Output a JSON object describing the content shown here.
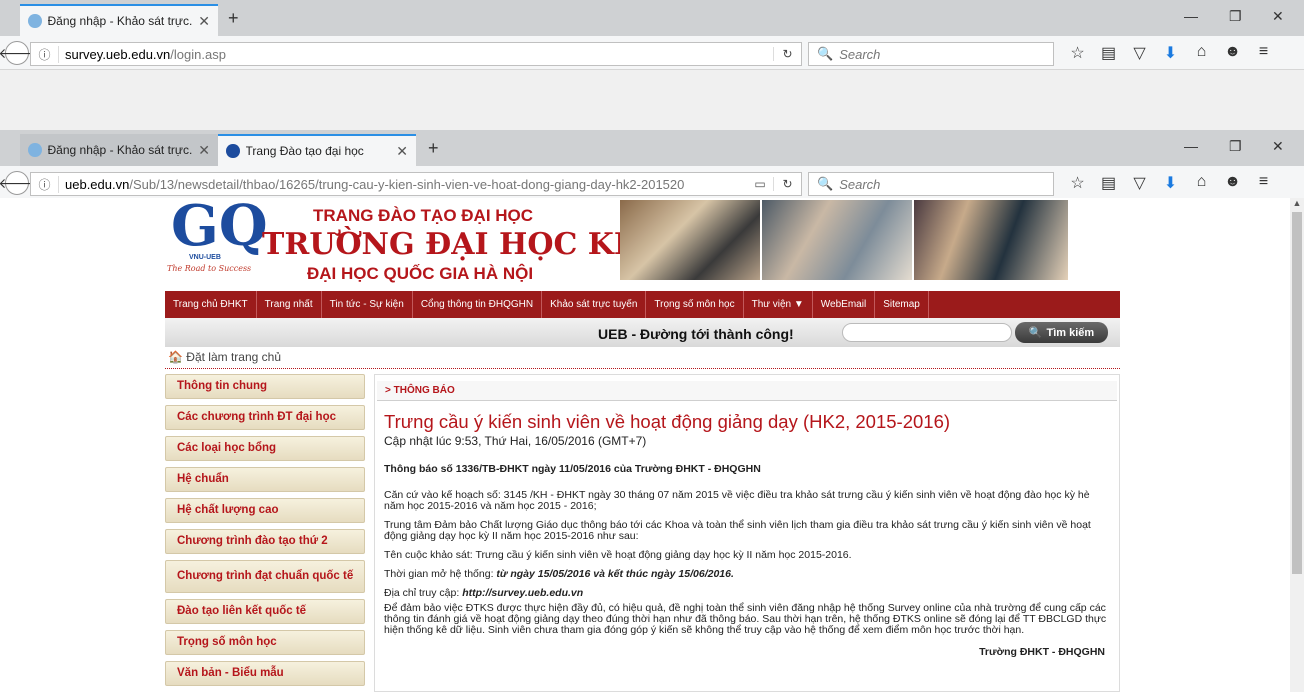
{
  "window1": {
    "tabs": [
      {
        "label": "Đăng nhập - Khảo sát trực..."
      }
    ],
    "url_domain": "survey.ueb.edu.vn",
    "url_path": "/login.asp",
    "search_placeholder": "Search"
  },
  "window2": {
    "tabs": [
      {
        "label": "Đăng nhập - Khảo sát trực..."
      },
      {
        "label": "Trang Đào tạo đại học"
      }
    ],
    "url_domain": "ueb.edu.vn",
    "url_path": "/Sub/13/newsdetail/thbao/16265/trung-cau-y-kien-sinh-vien-ve-hoat-dong-giang-day-hk2-201520",
    "search_placeholder": "Search"
  },
  "header": {
    "line1": "TRANG ĐÀO TẠO ĐẠI HỌC",
    "line2": "TRƯỜNG ĐẠI HỌC KINH TẾ",
    "line3": "ĐẠI HỌC QUỐC GIA HÀ NỘI",
    "logo_sub": "VNU-UEB",
    "logo_tagline": "The Road to Success"
  },
  "menu": [
    "Trang chủ ĐHKT",
    "Trang nhất",
    "Tin tức - Sự kiện",
    "Cổng thông tin ĐHQGHN",
    "Khảo sát trực tuyến",
    "Trọng số môn học",
    "Thư viện ▼",
    "WebEmail",
    "Sitemap"
  ],
  "slogan": "UEB - Đường tới thành công!",
  "search_button": "Tìm kiếm",
  "home_link": "Đặt làm trang chủ",
  "sidebar": [
    "Thông tin chung",
    "Các chương trình ĐT đại học",
    "Các loại học bổng",
    "Hệ chuẩn",
    "Hệ chất lượng cao",
    "Chương trình đào tạo thứ 2",
    "Chương trình đạt chuẩn quốc tế",
    "Đào tạo liên kết quốc tế",
    "Trọng số môn học",
    "Văn bản - Biểu mẫu"
  ],
  "article": {
    "section": "> THÔNG BÁO",
    "title": "Trưng cầu ý kiến sinh viên về hoạt động giảng dạy (HK2, 2015-2016)",
    "updated": "Cập nhật lúc 9:53, Thứ Hai, 16/05/2016 (GMT+7)",
    "notice_no": "Thông báo số 1336/TB-ĐHKT ngày 11/05/2016 của Trường ĐHKT - ĐHQGHN",
    "p1": "Căn cứ vào kế hoạch số: 3145 /KH - ĐHKT ngày 30 tháng 07 năm 2015 về việc điều tra khảo sát trưng cầu ý kiến sinh viên về hoạt động đào học kỳ hè năm học 2015-2016 và năm học 2015 - 2016;",
    "p2": "Trung tâm Đảm bảo Chất lượng Giáo dục thông báo tới các Khoa và toàn thể sinh viên lịch tham gia điều tra khảo sát trưng cầu ý kiến sinh viên về hoạt động giảng dạy học kỳ II năm học 2015-2016 như sau:",
    "p3": "Tên cuộc khảo sát: Trưng cầu ý kiến sinh viên về hoạt động giảng dạy học kỳ II năm học 2015-2016.",
    "p4_label": "Thời gian mở hệ thống: ",
    "p4_value": "từ ngày 15/05/2016 và kết thúc ngày 15/06/2016.",
    "p5_label": "Địa chỉ truy cập: ",
    "p5_value": "http://survey.ueb.edu.vn",
    "p6": "Để đảm bảo việc ĐTKS được thực hiện đầy đủ, có hiệu quả, đề nghị toàn thể sinh viên đăng nhập hệ thống Survey online của nhà trường để cung cấp các thông tin đánh giá về hoạt động giảng dạy theo đúng thời hạn như đã thông báo. Sau thời hạn trên, hệ thống ĐTKS online sẽ đóng lại để TT ĐBCLGD thực hiện thống kê dữ liệu. Sinh viên chưa tham gia đóng góp ý kiến sẽ không thể truy cập vào hệ thống để xem điểm môn học trước thời hạn.",
    "signature": "Trường ĐHKT - ĐHQGHN"
  }
}
